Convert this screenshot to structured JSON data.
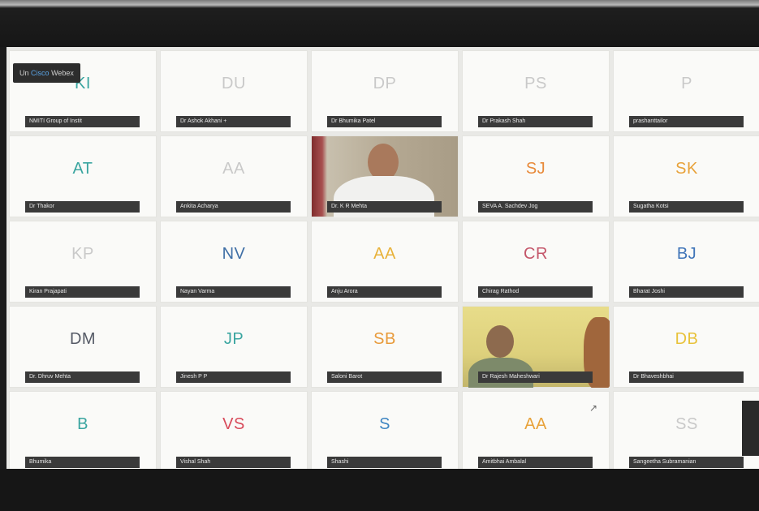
{
  "meeting": {
    "badge_prefix": "Un",
    "badge_accent": "Cisco",
    "badge_suffix": "Webex"
  },
  "participants": [
    {
      "initials": "KI",
      "name": "NMITI Group of Instit",
      "color": "#3aa5a0"
    },
    {
      "initials": "DU",
      "name": "Dr Ashok Akhani +",
      "color": "#c9c9c9"
    },
    {
      "initials": "DP",
      "name": "Dr Bhumika Patel",
      "color": "#c9c9c9"
    },
    {
      "initials": "PS",
      "name": "Dr Prakash Shah",
      "color": "#c9c9c9"
    },
    {
      "initials": "P",
      "name": "prashanttailor",
      "color": "#c9c9c9"
    },
    {
      "initials": "AT",
      "name": "Dr Thakor",
      "color": "#3aa5a0"
    },
    {
      "initials": "AA",
      "name": "Ankita Acharya",
      "color": "#c9c9c9"
    },
    {
      "video": "video-1",
      "name": "Dr. K R Mehta",
      "color": "#000"
    },
    {
      "initials": "SJ",
      "name": "SEVA A. Sachdev Jog",
      "color": "#e88a3a"
    },
    {
      "initials": "SK",
      "name": "Sugatha Kotsi",
      "color": "#e8a23a"
    },
    {
      "initials": "KP",
      "name": "Kiran Prajapati",
      "color": "#c9c9c9"
    },
    {
      "initials": "NV",
      "name": "Nayan Varma",
      "color": "#3f6fa6"
    },
    {
      "initials": "AA",
      "name": "Anju Arora",
      "color": "#e8b23a"
    },
    {
      "initials": "CR",
      "name": "Chirag Rathod",
      "color": "#c4566a"
    },
    {
      "initials": "BJ",
      "name": "Bharat Joshi",
      "color": "#3f74b8"
    },
    {
      "initials": "DM",
      "name": "Dr. Dhruv Mehta",
      "color": "#555a66"
    },
    {
      "initials": "JP",
      "name": "Jinesh P P",
      "color": "#3aa5a0"
    },
    {
      "initials": "SB",
      "name": "Saloni Barot",
      "color": "#e89a3a"
    },
    {
      "video": "video-2",
      "name": "Dr Rajesh Maheshwari",
      "color": "#000"
    },
    {
      "initials": "DB",
      "name": "Dr Bhaveshbhai",
      "color": "#e8c23a"
    },
    {
      "initials": "B",
      "name": "Bhumika",
      "color": "#3aa5a0"
    },
    {
      "initials": "VS",
      "name": "Vishal Shah",
      "color": "#d84a5a"
    },
    {
      "initials": "S",
      "name": "Shashi",
      "color": "#3f86c2"
    },
    {
      "initials": "AA",
      "name": "Amitbhai Ambalal",
      "color": "#e8a23a"
    },
    {
      "initials": "SS",
      "name": "Sangeetha Subramanian",
      "color": "#c9c9c9"
    }
  ]
}
